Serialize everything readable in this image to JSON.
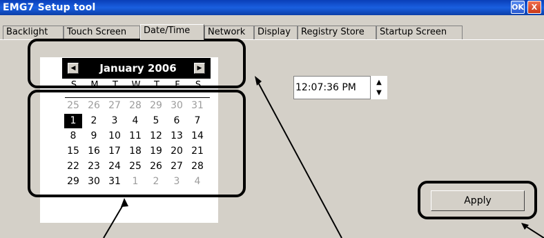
{
  "window": {
    "title": "EMG7 Setup tool",
    "ok_label": "OK",
    "close_label": "X"
  },
  "tabs": [
    {
      "label": "Backlight"
    },
    {
      "label": "Touch Screen"
    },
    {
      "label": "Date/Time",
      "active": true
    },
    {
      "label": "Network"
    },
    {
      "label": "Display"
    },
    {
      "label": "Registry Store"
    },
    {
      "label": "Startup Screen"
    }
  ],
  "calendar": {
    "month_label": "January 2006",
    "prev_icon": "arrow-left-icon",
    "next_icon": "arrow-right-icon",
    "days_of_week": [
      "S",
      "M",
      "T",
      "W",
      "T",
      "F",
      "S"
    ],
    "weeks": [
      [
        25,
        26,
        27,
        28,
        29,
        30,
        31
      ],
      [
        1,
        2,
        3,
        4,
        5,
        6,
        7
      ],
      [
        8,
        9,
        10,
        11,
        12,
        13,
        14
      ],
      [
        15,
        16,
        17,
        18,
        19,
        20,
        21
      ],
      [
        22,
        23,
        24,
        25,
        26,
        27,
        28
      ],
      [
        29,
        30,
        31,
        1,
        2,
        3,
        4
      ]
    ],
    "selected_day": 1
  },
  "time": {
    "value": "12:07:36 PM",
    "up_icon": "spin-up-icon",
    "down_icon": "spin-down-icon"
  },
  "apply_label": "Apply",
  "colors": {
    "titlebar": "#1a5fe0",
    "face": "#d4d0c8",
    "annotation": "#000000",
    "selected_bg": "#000000"
  }
}
